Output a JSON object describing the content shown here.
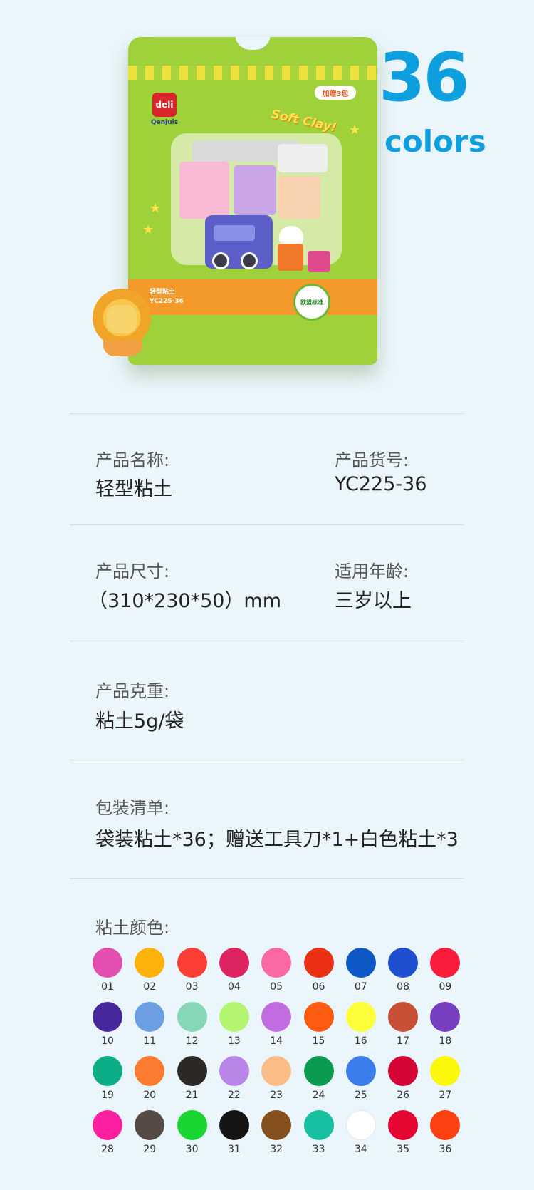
{
  "hero": {
    "brand": "deli",
    "sub_brand": "Qenjuis",
    "bonus_badge": "加赠3包",
    "tagline": "Soft Clay!",
    "pack_label_line1": "轻型粘土",
    "pack_label_line2": "YC225-36",
    "seal_text": "欧盟标准",
    "count": "36",
    "count_unit": "colors"
  },
  "specs": {
    "name_label": "产品名称:",
    "name_value": "轻型粘土",
    "code_label": "产品货号:",
    "code_value": "YC225-36",
    "size_label": "产品尺寸:",
    "size_value": "（310*230*50）mm",
    "age_label": "适用年龄:",
    "age_value": "三岁以上",
    "weight_label": "产品克重:",
    "weight_value": "粘土5g/袋",
    "contents_label": "包装清单:",
    "contents_value": "袋装粘土*36；赠送工具刀*1+白色粘土*3",
    "colors_label": "粘土颜色:"
  },
  "swatches": [
    {
      "num": "01",
      "color": "#e34fb0"
    },
    {
      "num": "02",
      "color": "#ffb20c"
    },
    {
      "num": "03",
      "color": "#fb3f35"
    },
    {
      "num": "04",
      "color": "#dd2361"
    },
    {
      "num": "05",
      "color": "#fb68a4"
    },
    {
      "num": "06",
      "color": "#ea3115"
    },
    {
      "num": "07",
      "color": "#0e58c5"
    },
    {
      "num": "08",
      "color": "#1d4fcf"
    },
    {
      "num": "09",
      "color": "#fa1c3a"
    },
    {
      "num": "10",
      "color": "#47279c"
    },
    {
      "num": "11",
      "color": "#6c9ee2"
    },
    {
      "num": "12",
      "color": "#86d7b5"
    },
    {
      "num": "13",
      "color": "#b3f471"
    },
    {
      "num": "14",
      "color": "#c16ce0"
    },
    {
      "num": "15",
      "color": "#fd5b12"
    },
    {
      "num": "16",
      "color": "#feff3b"
    },
    {
      "num": "17",
      "color": "#c64f35"
    },
    {
      "num": "18",
      "color": "#7840c0"
    },
    {
      "num": "19",
      "color": "#0cae87"
    },
    {
      "num": "20",
      "color": "#fc7b30"
    },
    {
      "num": "21",
      "color": "#2b2825"
    },
    {
      "num": "22",
      "color": "#ba85e9"
    },
    {
      "num": "23",
      "color": "#fbbd85"
    },
    {
      "num": "24",
      "color": "#0a9b50"
    },
    {
      "num": "25",
      "color": "#3b7deb"
    },
    {
      "num": "26",
      "color": "#d40436"
    },
    {
      "num": "27",
      "color": "#fdf60d"
    },
    {
      "num": "28",
      "color": "#fc1fa0"
    },
    {
      "num": "29",
      "color": "#554b44"
    },
    {
      "num": "30",
      "color": "#19d532"
    },
    {
      "num": "31",
      "color": "#151414"
    },
    {
      "num": "32",
      "color": "#85501e"
    },
    {
      "num": "33",
      "color": "#17c0a0"
    },
    {
      "num": "34",
      "color": "#ffffff"
    },
    {
      "num": "35",
      "color": "#e50732"
    },
    {
      "num": "36",
      "color": "#fd4212"
    }
  ]
}
